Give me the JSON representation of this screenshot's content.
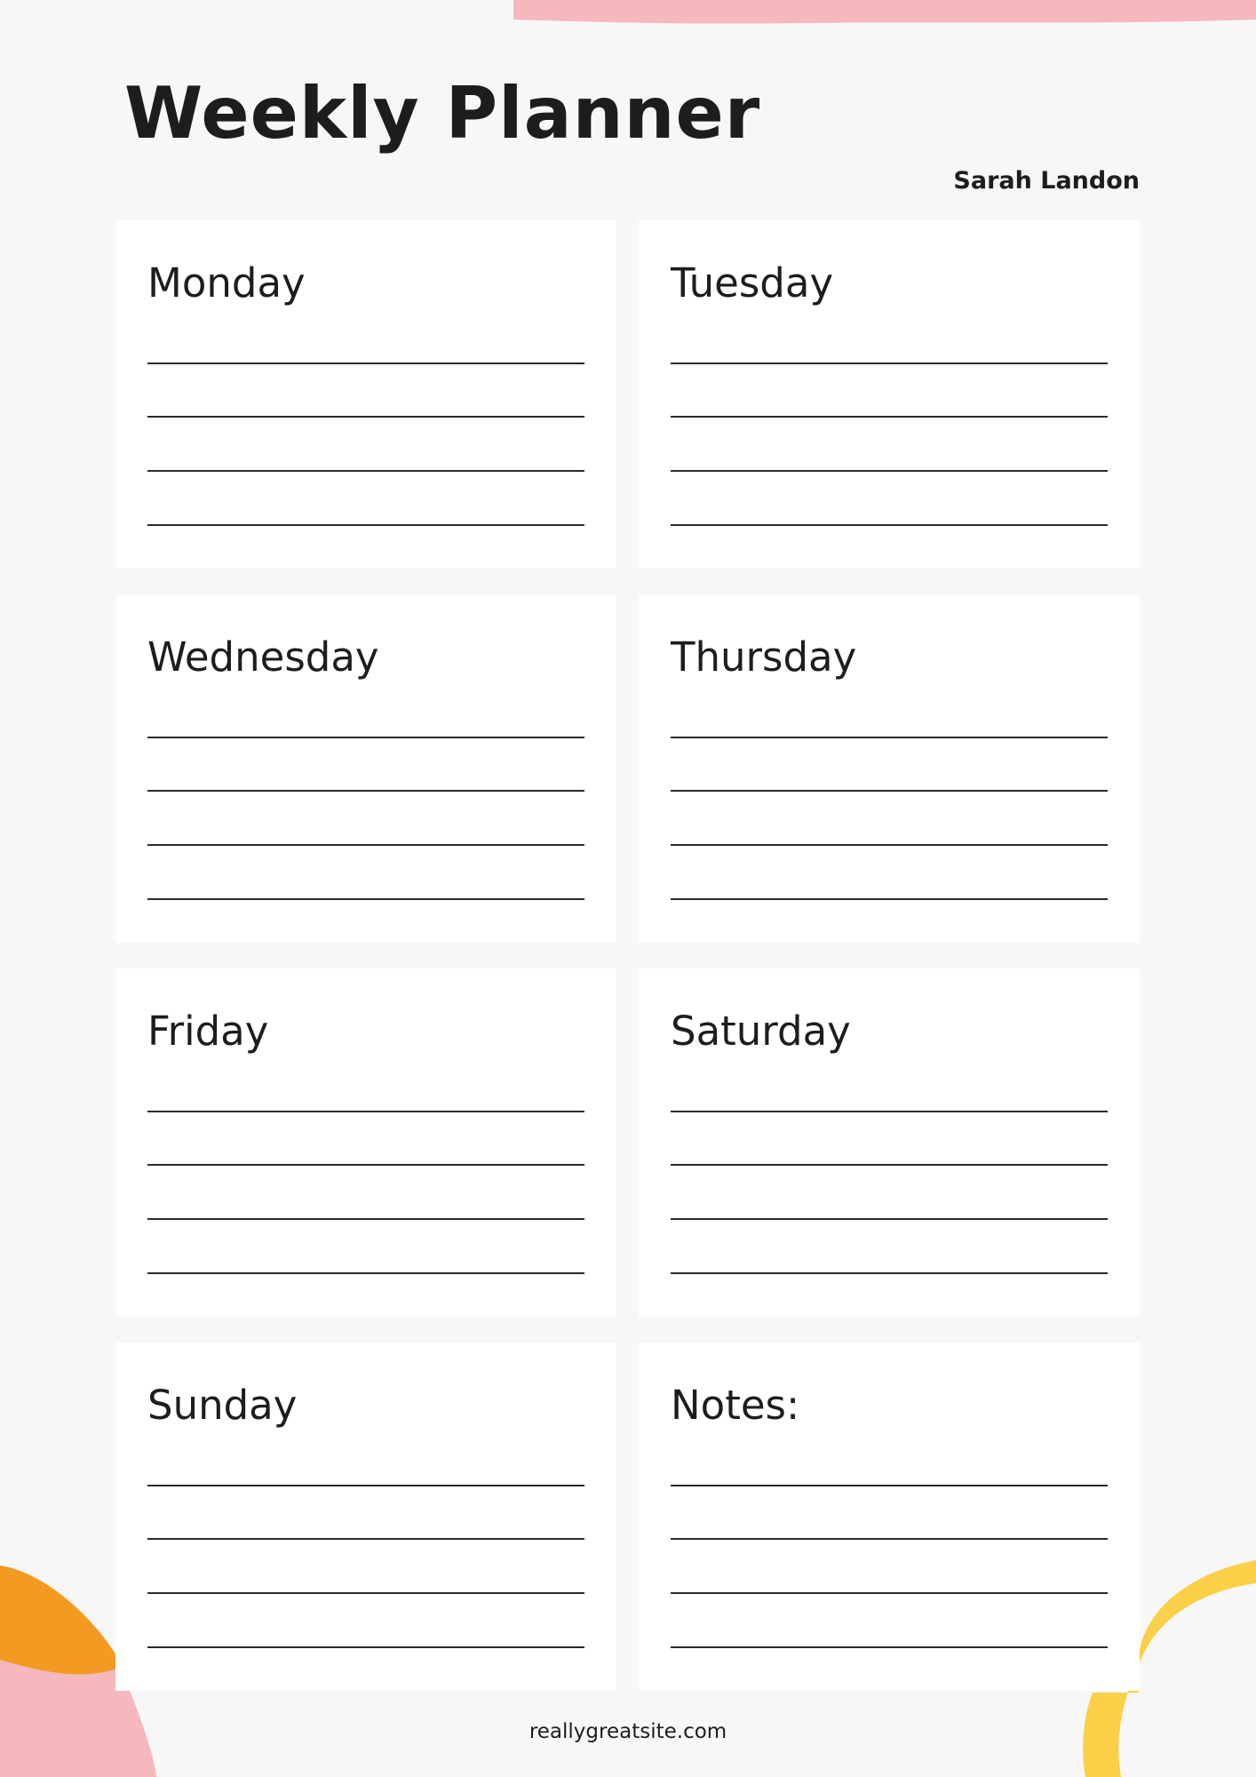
{
  "planner": {
    "title": "Weekly Planner",
    "owner": "Sarah Landon",
    "cards": [
      {
        "label": "Monday"
      },
      {
        "label": "Tuesday"
      },
      {
        "label": "Wednesday"
      },
      {
        "label": "Thursday"
      },
      {
        "label": "Friday"
      },
      {
        "label": "Saturday"
      },
      {
        "label": "Sunday"
      },
      {
        "label": "Notes:"
      }
    ],
    "footer": "reallygreatsite.com"
  },
  "colors": {
    "background": "#f7f7f7",
    "card": "#ffffff",
    "text": "#1d1d1d",
    "pink": "#f5b8bd",
    "orange": "#f29a22",
    "yellow": "#fbcf47"
  }
}
